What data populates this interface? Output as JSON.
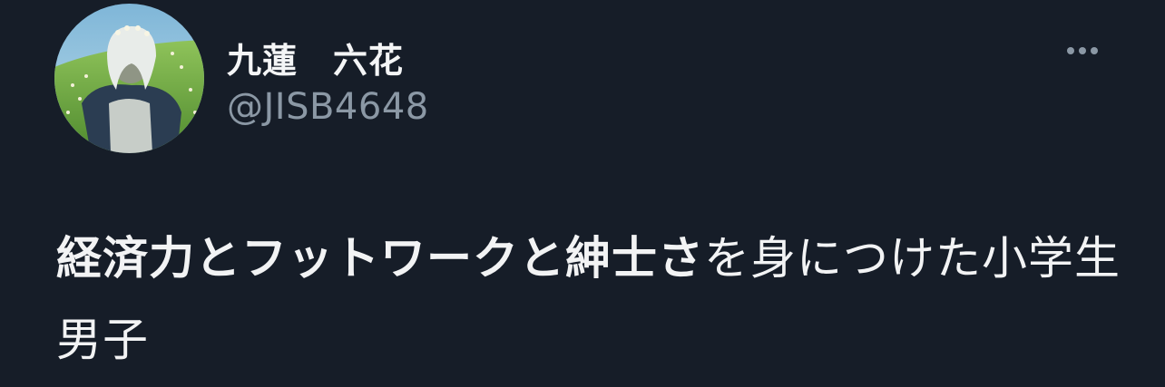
{
  "tweet": {
    "author": {
      "display_name": "九蓮　六花",
      "handle": "@JISB4648",
      "avatar_icon": "profile-avatar"
    },
    "more_icon": "more-options-icon",
    "text_bold": "経済力とフットワークと紳士さ",
    "text_rest": "を身につけた小学生男子"
  },
  "colors": {
    "background": "#161d28",
    "primary_text": "#e7e9ea",
    "secondary_text": "#8b98a5"
  }
}
